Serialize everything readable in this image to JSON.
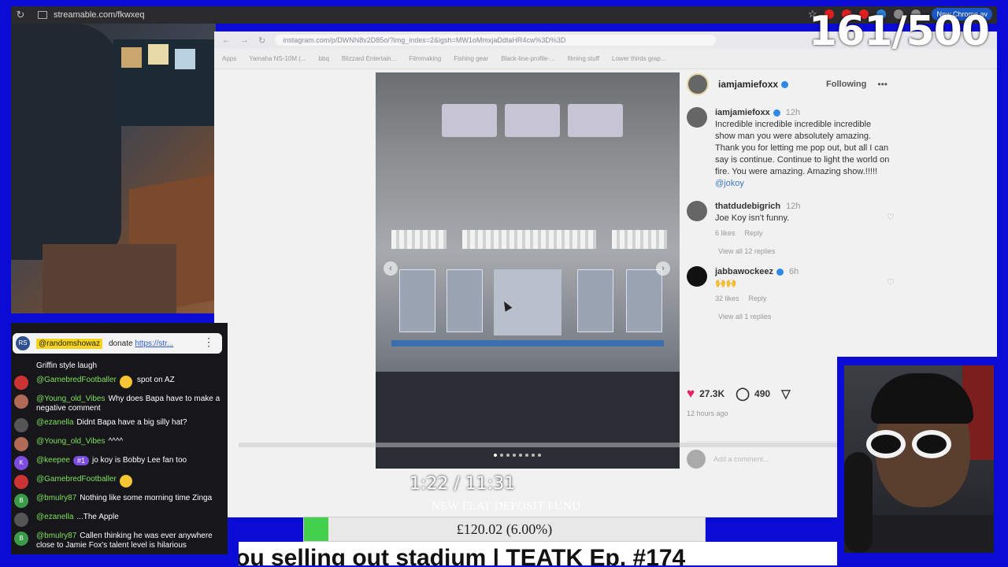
{
  "browser": {
    "url": "streamable.com/fkwxeq",
    "new_chrome_label": "New Chrome av",
    "reload_icon": "reload-icon",
    "star_icon": "star-icon"
  },
  "stream_counter": "161/500",
  "captured_browser": {
    "url": "instagram.com/p/DWNN8v2D85o/?img_index=2&igsh=MW1oMmxjaDdtaHR4cw%3D%3D",
    "bookmarks": [
      "Apps",
      "Yamaha NS-10M (...",
      "bbq",
      "Blizzard Entertain...",
      "Filmmaking",
      "Fishing gear",
      "Black-line-profile-...",
      "filming stuff",
      "Lower thirds grap..."
    ]
  },
  "instagram": {
    "author": "iamjamiefoxx",
    "follow_label": "Following",
    "caption": {
      "user": "iamjamiefoxx",
      "time": "12h",
      "text": "Incredible incredible incredible incredible show man you were absolutely amazing. Thank you for letting me pop out, but all I can say is continue. Continue to light the world on fire. You were amazing. Amazing show.!!!!!",
      "mention": "@jokoy"
    },
    "comments": [
      {
        "user": "thatdudebigrich",
        "time": "12h",
        "text": "Joe Koy isn't funny.",
        "likes": "6 likes",
        "reply": "Reply",
        "view_replies": "View all 12 replies"
      },
      {
        "user": "jabbawockeez",
        "time": "6h",
        "text": "🙌🙌",
        "likes": "32 likes",
        "reply": "Reply",
        "view_replies": "View all 1 replies"
      }
    ],
    "like_count": "27.3K",
    "comment_count": "490",
    "posted_ago": "12 hours ago",
    "add_comment_placeholder": "Add a comment..."
  },
  "chat": {
    "pinned": {
      "avatar": "RS",
      "user": "@randomshowaz",
      "text": "donate ",
      "link": "https://str..."
    },
    "messages": [
      {
        "avatar": "",
        "user": "",
        "badge": "",
        "text": "Griffin style laugh",
        "color": "#8a6bd6"
      },
      {
        "avatar": "",
        "user": "@GamebredFootballer",
        "badge": "",
        "text": "spot on AZ",
        "color": "#c33"
      },
      {
        "avatar": "",
        "user": "@Young_old_Vibes",
        "badge": "",
        "text": "Why does Bapa have to make a negative comment",
        "color": "#b06a55"
      },
      {
        "avatar": "",
        "user": "@ezanella",
        "badge": "",
        "text": "Didnt Bapa have a big silly hat?",
        "color": "#666"
      },
      {
        "avatar": "",
        "user": "@Young_old_Vibes",
        "badge": "",
        "text": "^^^^",
        "color": "#b06a55"
      },
      {
        "avatar": "K",
        "user": "@keepee",
        "badge": "#1",
        "text": "jo koy is Bobby Lee fan too",
        "color": "#7c4be0"
      },
      {
        "avatar": "",
        "user": "@GamebredFootballer",
        "badge": "",
        "text": "",
        "color": "#c33"
      },
      {
        "avatar": "B",
        "user": "@bmulry87",
        "badge": "",
        "text": "Nothing like some morning time Zinga",
        "color": "#3a9a4a"
      },
      {
        "avatar": "",
        "user": "@ezanella",
        "badge": "",
        "text": "...The Apple",
        "color": "#666"
      },
      {
        "avatar": "B",
        "user": "@bmulry87",
        "badge": "",
        "text": "Callen thinking he was ever anywhere close to Jamie Fox's talent level is hilarious",
        "color": "#3a9a4a"
      }
    ]
  },
  "overlay": {
    "timer": "1:22 / 11:31",
    "fund_title": "NEW FLAT DEPOSIT FUND",
    "fund_amount": "£120.02 (6.00%)",
    "fund_progress": 0.06,
    "marquee": "ou selling out stadium | TEATK Ep. #174"
  },
  "colors": {
    "frame": "#0b0bd6",
    "progress": "#43d04c",
    "username": "#7ee05a",
    "pin_highlight": "#f4d51c"
  }
}
